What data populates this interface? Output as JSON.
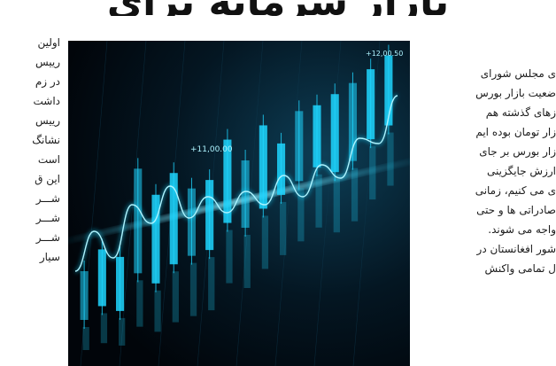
{
  "headline": "بازار سرمایه برای",
  "article_right_lines": [
    "ی مجلس شورای",
    "ضعیت بازار بورس",
    "زهای گذشته هم",
    "زار تومان بوده ایم",
    "زار بورس بر جای",
    "ارزش جایگزینی",
    "ی می کنیم، زمانی",
    "صادراتی ها و حتی",
    "واجه می شوند.",
    "شور افغانستان در",
    "ل تمامی واکنش"
  ],
  "article_left_lines": [
    "اولین",
    "رییس",
    "در زم",
    "داشت",
    "رییس",
    "نشانگ",
    "است",
    "این ق",
    "شـــر",
    "شـــر",
    "شـــر",
    "سیار"
  ],
  "image": {
    "alt": "نمودار شمعی بازار سهام",
    "label_top": "+12,00.50",
    "label_mid": "+11,00.00",
    "colors": {
      "background": "#02070c",
      "primary": "#1fd6ff",
      "glow": "#aef4ff"
    },
    "candles": [
      {
        "low": 5,
        "high": 22
      },
      {
        "low": 10,
        "high": 30
      },
      {
        "low": 8,
        "high": 27
      },
      {
        "low": 22,
        "high": 60
      },
      {
        "low": 18,
        "high": 50
      },
      {
        "low": 25,
        "high": 58
      },
      {
        "low": 28,
        "high": 52
      },
      {
        "low": 30,
        "high": 55
      },
      {
        "low": 40,
        "high": 70
      },
      {
        "low": 38,
        "high": 62
      },
      {
        "low": 45,
        "high": 75
      },
      {
        "low": 50,
        "high": 68
      },
      {
        "low": 55,
        "high": 80
      },
      {
        "low": 60,
        "high": 82
      },
      {
        "low": 58,
        "high": 86
      },
      {
        "low": 62,
        "high": 90
      },
      {
        "low": 70,
        "high": 95
      },
      {
        "low": 75,
        "high": 100
      }
    ],
    "curve": [
      30,
      45,
      35,
      55,
      48,
      62,
      50,
      58,
      52,
      60,
      55,
      66,
      58,
      70,
      65,
      80,
      78,
      96
    ]
  }
}
